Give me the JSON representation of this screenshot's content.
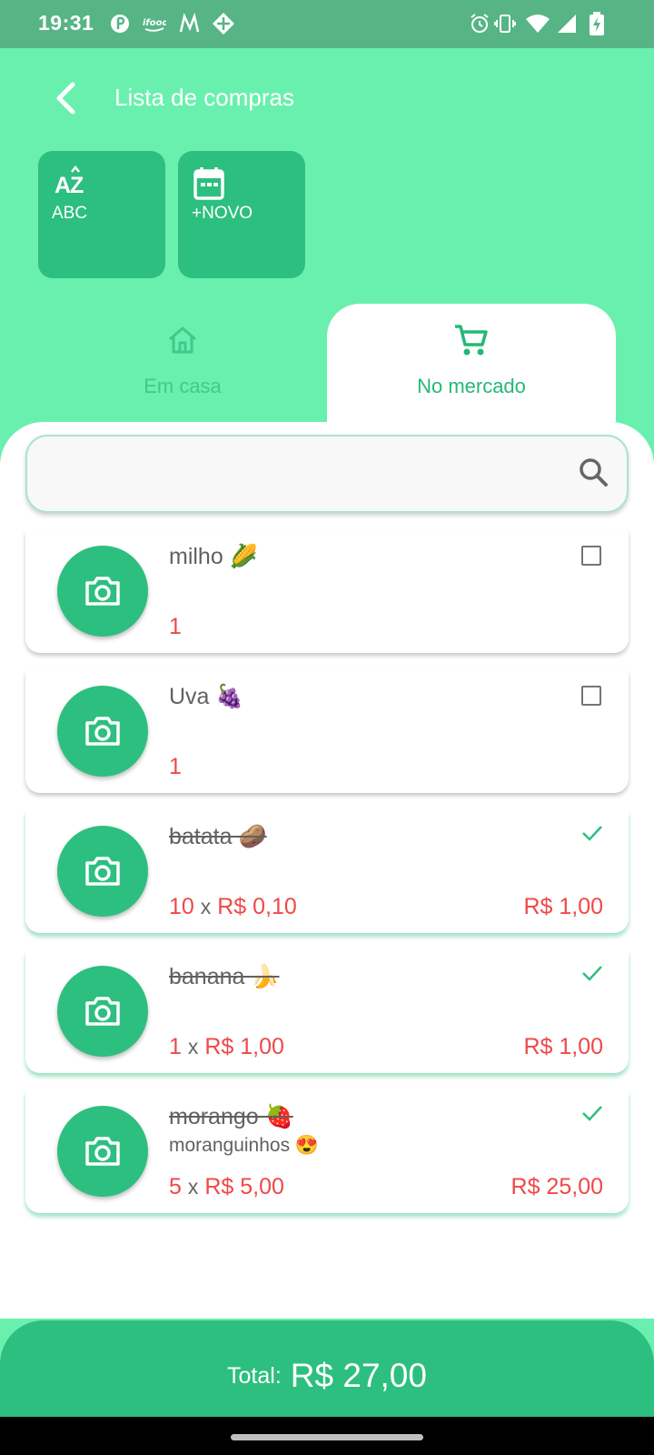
{
  "status_bar": {
    "time": "19:31",
    "left_icons": [
      "notification-app-icon",
      "ifood-icon",
      "m-app-icon",
      "location-app-icon"
    ],
    "right_icons": [
      "alarm-icon",
      "vibrate-icon",
      "wifi-icon",
      "signal-icon",
      "battery-charging-icon"
    ]
  },
  "header": {
    "title": "Lista de compras"
  },
  "actions": [
    {
      "label": "ABC",
      "icon": "sort-alpha-icon"
    },
    {
      "label": "+NOVO",
      "icon": "calendar-icon"
    }
  ],
  "tabs": [
    {
      "label": "Em casa",
      "icon": "home-icon",
      "active": false
    },
    {
      "label": "No mercado",
      "icon": "cart-icon",
      "active": true
    }
  ],
  "search": {
    "placeholder": "",
    "value": ""
  },
  "items": [
    {
      "name": "milho 🌽",
      "note": "",
      "quantity": "1",
      "unit_price": "",
      "total": "",
      "checked": false
    },
    {
      "name": "Uva 🍇",
      "note": "",
      "quantity": "1",
      "unit_price": "",
      "total": "",
      "checked": false
    },
    {
      "name": "batata 🥔",
      "note": "",
      "quantity": "10",
      "multiply": "x",
      "unit_price": "R$ 0,10",
      "total": "R$ 1,00",
      "checked": true
    },
    {
      "name": "banana 🍌",
      "note": "",
      "quantity": "1",
      "multiply": "x",
      "unit_price": "R$ 1,00",
      "total": "R$ 1,00",
      "checked": true
    },
    {
      "name": "morango 🍓",
      "note": "moranguinhos 😍",
      "quantity": "5",
      "multiply": "x",
      "unit_price": "R$ 5,00",
      "total": "R$ 25,00",
      "checked": true
    }
  ],
  "footer": {
    "total_label": "Total:",
    "total_value": "R$ 27,00"
  },
  "colors": {
    "background": "#6af0ae",
    "accent": "#2dbf7f",
    "price": "#f04848",
    "status_bar": "#57b585"
  }
}
